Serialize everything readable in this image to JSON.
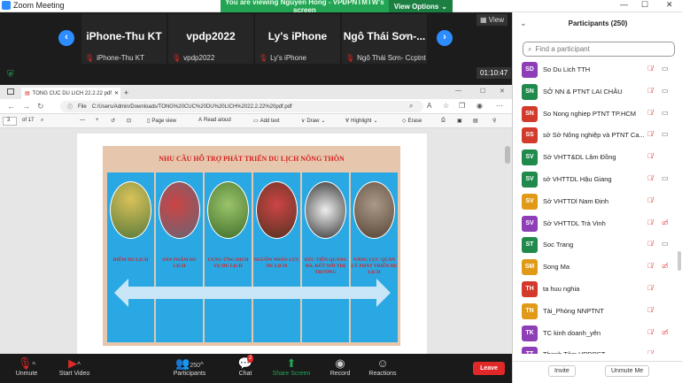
{
  "window": {
    "title": "Zoom Meeting"
  },
  "share_banner": {
    "text": "You are viewing Nguyen Hong - VPĐPNTMTW's screen",
    "options_label": "View Options"
  },
  "meeting": {
    "tiles": [
      {
        "big": "iPhone-Thu KT",
        "small": "iPhone-Thu KT"
      },
      {
        "big": "vpdp2022",
        "small": "vpdp2022"
      },
      {
        "big": "Ly's iPhone",
        "small": "Ly's iPhone"
      },
      {
        "big": "Ngô Thái Sơn-...",
        "small": "Ngô Thái Sơn- Ccptnt"
      }
    ],
    "view_label": "View",
    "timer": "01:10:47"
  },
  "browser": {
    "tab_title": "TONG CUC DU LICH 22.2.22 pdf",
    "file_label": "File",
    "url": "C:/Users/Admin/Downloads/TONG%20CUC%20DU%20LICH%2022.2.22%20pdf.pdf",
    "page_num": "3",
    "page_total": "of 17",
    "tools": {
      "page_view": "Page view",
      "read_aloud": "Read aloud",
      "add_text": "Add text",
      "draw": "Draw",
      "highlight": "Highlight",
      "erase": "Erase"
    }
  },
  "slide": {
    "title": "NHU CẦU HỖ TRỢ PHÁT TRIỂN DU LỊCH NÔNG THÔN",
    "columns": [
      {
        "label": "ĐIỂM DU LỊCH"
      },
      {
        "label": "SẢN PHẨM DU LỊCH"
      },
      {
        "label": "CUNG ỨNG DỊCH VỤ DU LỊCH"
      },
      {
        "label": "NGUỒN NHÂN LỰC DU LỊCH"
      },
      {
        "label": "XÚC TIẾN QUẢNG BÁ, KẾT NỐI THỊ TRƯỜNG"
      },
      {
        "label": "NĂNG LỰC QUẢN LÝ PHÁT TRIỂN DU LỊCH"
      }
    ]
  },
  "controls": {
    "unmute": "Unmute",
    "start_video": "Start Video",
    "participants": "Participants",
    "participant_count": "250",
    "chat": "Chat",
    "chat_badge": "2",
    "share_screen": "Share Screen",
    "record": "Record",
    "reactions": "Reactions",
    "leave": "Leave"
  },
  "panel": {
    "header": "Participants (250)",
    "search_placeholder": "Find a participant",
    "participants": [
      {
        "initials": "SD",
        "name": "So Du Lich TTH",
        "color": "#8e3fb8",
        "video": "on"
      },
      {
        "initials": "SN",
        "name": "SỞ NN & PTNT LAI CHÂU",
        "color": "#1f8a4c",
        "video": "on"
      },
      {
        "initials": "SN",
        "name": "So Nong nghiep PTNT TP.HCM",
        "color": "#d23b2b",
        "video": "on"
      },
      {
        "initials": "SS",
        "name": "sở Sở Nông nghiệp và PTNT Ca...",
        "color": "#d23b2b",
        "video": "on"
      },
      {
        "initials": "SV",
        "name": "Sở VHTT&DL Lâm Đồng",
        "color": "#1f8a4c",
        "video": "none"
      },
      {
        "initials": "SV",
        "name": "sở VHTTDL Hậu Giang",
        "color": "#1f8a4c",
        "video": "on"
      },
      {
        "initials": "SV",
        "name": "Sở VHTTDl Nam Định",
        "color": "#e09a18",
        "video": "none"
      },
      {
        "initials": "SV",
        "name": "Sở VHTTDL Trà Vinh",
        "color": "#8e3fb8",
        "video": "off"
      },
      {
        "initials": "ST",
        "name": "Soc Trang",
        "color": "#1f8a4c",
        "video": "on"
      },
      {
        "initials": "SM",
        "name": "Song Ma",
        "color": "#e09a18",
        "video": "off"
      },
      {
        "initials": "TH",
        "name": "ta huu nghia",
        "color": "#d23b2b",
        "video": "none"
      },
      {
        "initials": "TN",
        "name": "Tài_Phòng NNPTNT",
        "color": "#e09a18",
        "video": "none"
      },
      {
        "initials": "TK",
        "name": "TC kinh doanh_yên",
        "color": "#8e3fb8",
        "video": "off"
      },
      {
        "initials": "TT",
        "name": "Thanh Tâm VPĐPST",
        "color": "#8e3fb8",
        "video": "none"
      }
    ],
    "invite": "Invite",
    "unmute_me": "Unmute Me"
  }
}
